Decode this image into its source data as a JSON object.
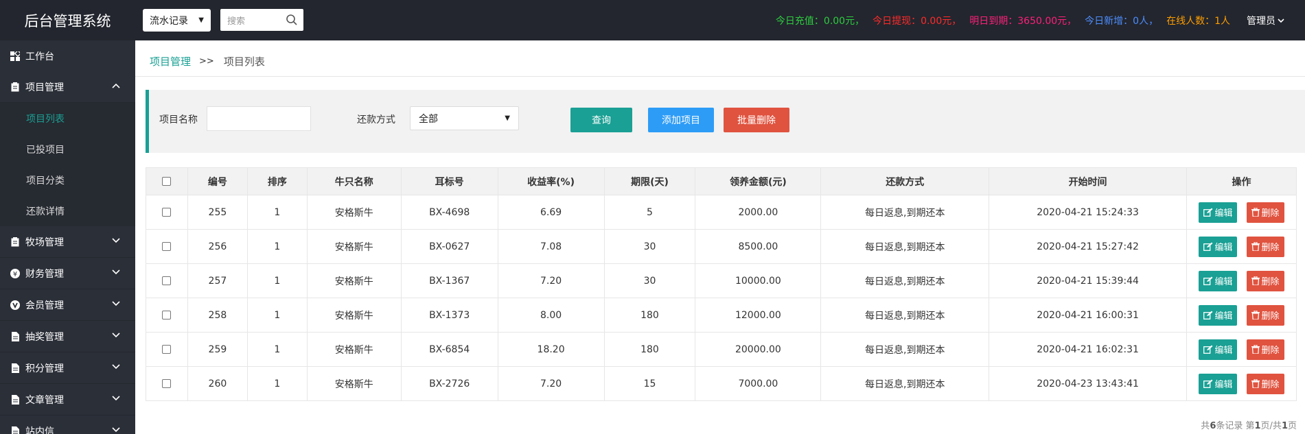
{
  "header": {
    "title": "后台管理系统",
    "type_select": "流水记录",
    "search_placeholder": "搜索",
    "stats": {
      "recharge": "今日充值：0.00元，",
      "withdraw": "今日提现：0.00元，",
      "due": "明日到期：3650.00元，",
      "new_users": "今日新增：0人，",
      "online": "在线人数：1人"
    },
    "admin_label": "管理员"
  },
  "sidebar": {
    "items": [
      {
        "label": "工作台",
        "icon": "dashboard-icon"
      },
      {
        "label": "项目管理",
        "icon": "clipboard-icon",
        "expanded": true,
        "children": [
          {
            "label": "项目列表",
            "active": true
          },
          {
            "label": "已投项目"
          },
          {
            "label": "项目分类"
          },
          {
            "label": "还款详情"
          }
        ]
      },
      {
        "label": "牧场管理",
        "icon": "clipboard-icon"
      },
      {
        "label": "财务管理",
        "icon": "yen-icon"
      },
      {
        "label": "会员管理",
        "icon": "v-icon"
      },
      {
        "label": "抽奖管理",
        "icon": "document-icon"
      },
      {
        "label": "积分管理",
        "icon": "document-icon"
      },
      {
        "label": "文章管理",
        "icon": "document-icon"
      },
      {
        "label": "站内信",
        "icon": "document-icon"
      }
    ]
  },
  "breadcrumb": {
    "parent": "项目管理",
    "separator": ">>",
    "current": "项目列表"
  },
  "filter": {
    "name_label": "项目名称",
    "name_value": "",
    "repay_label": "还款方式",
    "repay_selected": "全部",
    "query_button": "查询",
    "add_button": "添加项目",
    "batch_delete_button": "批量删除"
  },
  "table": {
    "columns": [
      "编号",
      "排序",
      "牛只名称",
      "耳标号",
      "收益率(%)",
      "期限(天)",
      "领养金额(元)",
      "还款方式",
      "开始时间",
      "操作"
    ],
    "rows": [
      {
        "id": "255",
        "sort": "1",
        "name": "安格斯牛",
        "tag": "BX-4698",
        "rate": "6.69",
        "days": "5",
        "amount": "2000.00",
        "repay": "每日返息,到期还本",
        "start": "2020-04-21 15:24:33"
      },
      {
        "id": "256",
        "sort": "1",
        "name": "安格斯牛",
        "tag": "BX-0627",
        "rate": "7.08",
        "days": "30",
        "amount": "8500.00",
        "repay": "每日返息,到期还本",
        "start": "2020-04-21 15:27:42"
      },
      {
        "id": "257",
        "sort": "1",
        "name": "安格斯牛",
        "tag": "BX-1367",
        "rate": "7.20",
        "days": "30",
        "amount": "10000.00",
        "repay": "每日返息,到期还本",
        "start": "2020-04-21 15:39:44"
      },
      {
        "id": "258",
        "sort": "1",
        "name": "安格斯牛",
        "tag": "BX-1373",
        "rate": "8.00",
        "days": "180",
        "amount": "12000.00",
        "repay": "每日返息,到期还本",
        "start": "2020-04-21 16:00:31"
      },
      {
        "id": "259",
        "sort": "1",
        "name": "安格斯牛",
        "tag": "BX-6854",
        "rate": "18.20",
        "days": "180",
        "amount": "20000.00",
        "repay": "每日返息,到期还本",
        "start": "2020-04-21 16:02:31"
      },
      {
        "id": "260",
        "sort": "1",
        "name": "安格斯牛",
        "tag": "BX-2726",
        "rate": "7.20",
        "days": "15",
        "amount": "7000.00",
        "repay": "每日返息,到期还本",
        "start": "2020-04-23 13:43:41"
      }
    ],
    "edit_label": "编辑",
    "delete_label": "删除"
  },
  "pager": {
    "total_prefix": "共",
    "total": "6",
    "total_suffix": "条记录 第",
    "page": "1",
    "page_mid": "页/共",
    "pages": "1",
    "page_suffix": "页"
  },
  "colors": {
    "accent": "#1aa094",
    "header_bg": "#23262e",
    "sidebar_bg": "#2b2f38",
    "add_blue": "#2d9cf7",
    "delete_red": "#e0533f"
  }
}
